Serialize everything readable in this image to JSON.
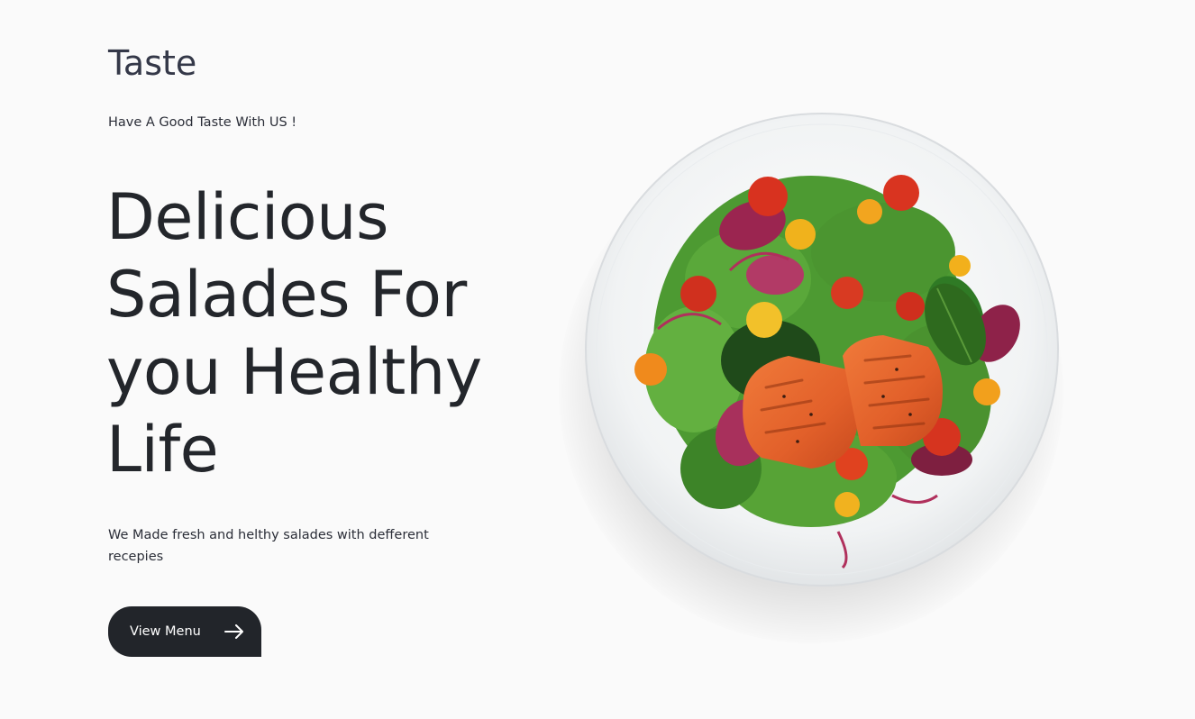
{
  "brand": {
    "logo_text": "Taste"
  },
  "hero": {
    "tagline": "Have A Good Taste With US !",
    "headline_lines": [
      "Delicious",
      "Salades For",
      "you Healthy",
      "Life"
    ],
    "subtitle": "We Made fresh and helthy salades with defferent recepies",
    "cta_label": "View Menu",
    "cta_icon": "arrow-right-icon"
  },
  "image": {
    "subject": "salmon-salad-plate"
  },
  "colors": {
    "background": "#fafafa",
    "text_dark": "#23262b",
    "button_bg": "#22252a",
    "button_text": "#ffffff"
  }
}
